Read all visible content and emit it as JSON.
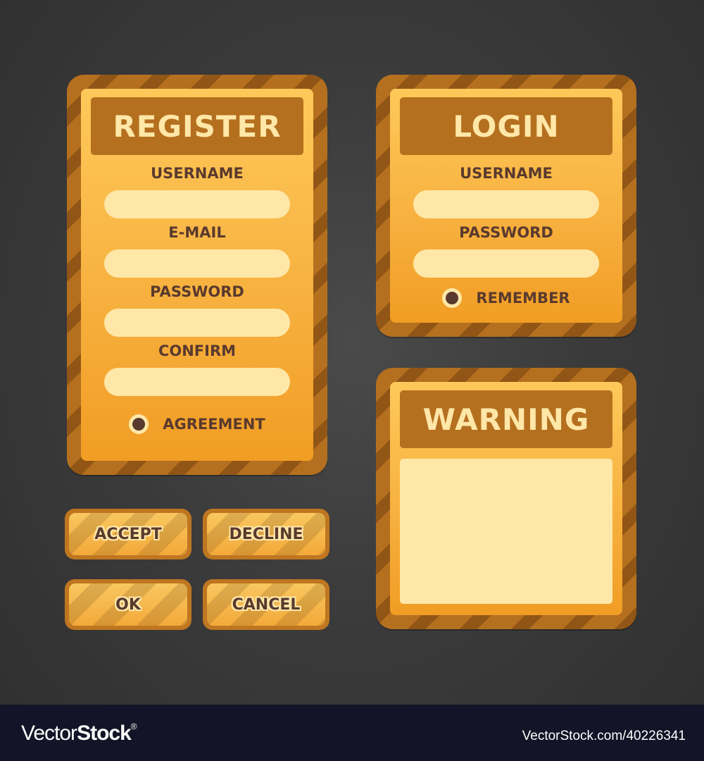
{
  "register": {
    "title": "REGISTER",
    "fields": [
      {
        "label": "USERNAME",
        "value": "",
        "placeholder": ""
      },
      {
        "label": "E-MAIL",
        "value": "",
        "placeholder": ""
      },
      {
        "label": "PASSWORD",
        "value": "",
        "placeholder": ""
      },
      {
        "label": "CONFIRM",
        "value": "",
        "placeholder": ""
      }
    ],
    "checkbox_label": "AGREEMENT",
    "checkbox_checked": true
  },
  "login": {
    "title": "LOGIN",
    "fields": [
      {
        "label": "USERNAME",
        "value": "",
        "placeholder": ""
      },
      {
        "label": "PASSWORD",
        "value": "",
        "placeholder": ""
      }
    ],
    "checkbox_label": "REMEMBER",
    "checkbox_checked": true
  },
  "warning": {
    "title": "WARNING",
    "body": ""
  },
  "buttons": {
    "accept": "ACCEPT",
    "decline": "DECLINE",
    "ok": "OK",
    "cancel": "CANCEL"
  },
  "colors": {
    "frame": "#b5701f",
    "frame_stripe": "#915616",
    "panel_top": "#fec95a",
    "panel_bottom": "#f19d24",
    "input_fill": "#ffe7a8",
    "text_dark": "#5a3a2e",
    "background": "#3b3b3b"
  },
  "footer": {
    "logo_light": "Vector",
    "logo_bold": "Stock",
    "logo_mark": "®",
    "url": "VectorStock.com/40226341"
  }
}
